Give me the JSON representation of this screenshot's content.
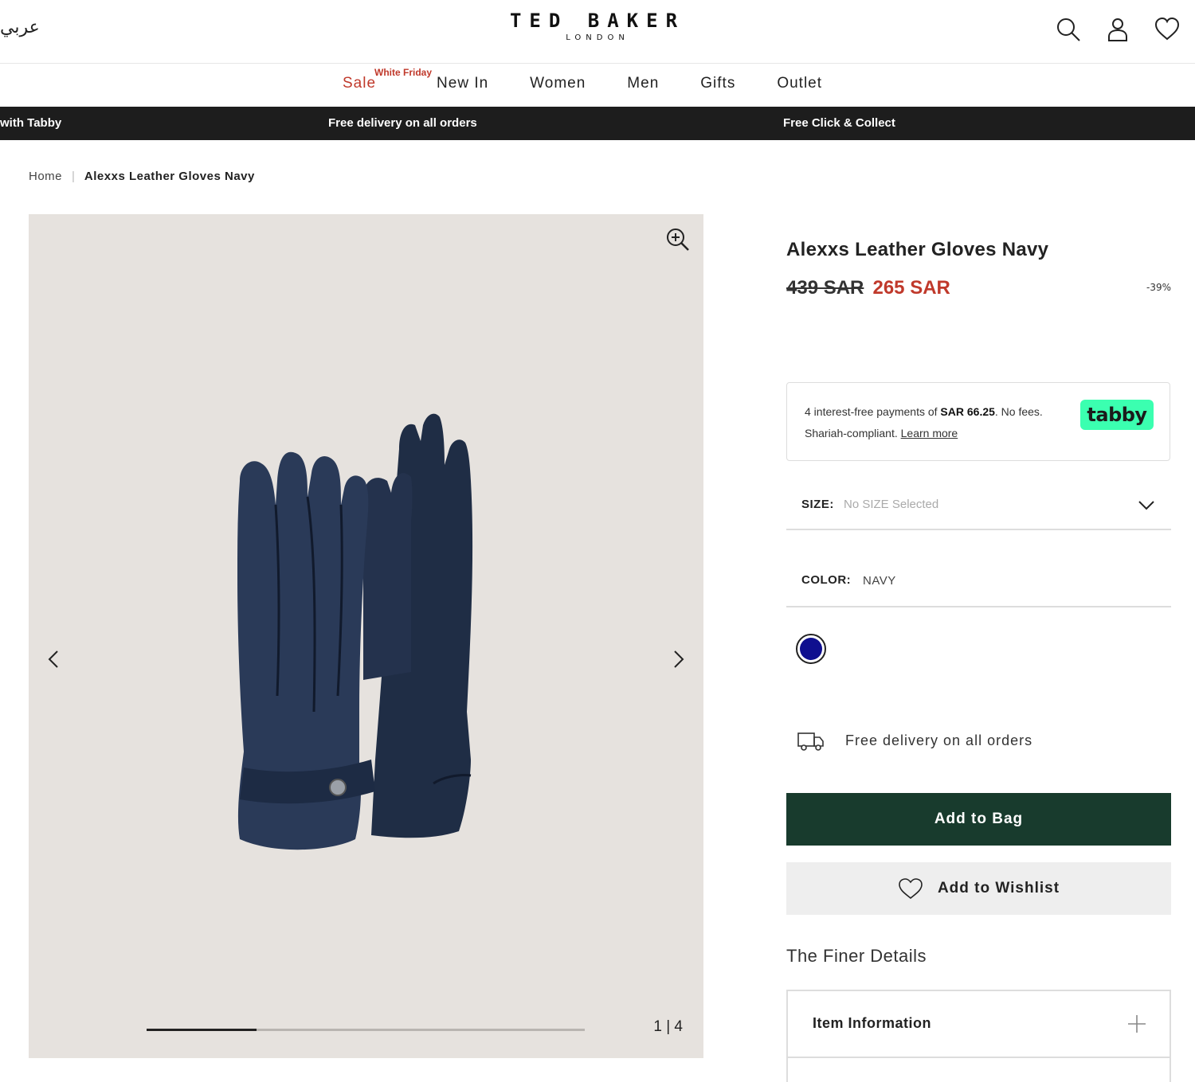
{
  "header": {
    "lang_label": "عربي",
    "logo_main": "TED BAKER",
    "logo_sub": "LONDON",
    "icons": [
      "search-icon",
      "account-icon",
      "wishlist-icon"
    ]
  },
  "nav": {
    "sale_label": "Sale",
    "sale_tag": "White Friday",
    "items": [
      "New In",
      "Women",
      "Men",
      "Gifts",
      "Outlet"
    ]
  },
  "promo": {
    "messages": [
      "with Tabby",
      "Free delivery on all orders",
      "Free Click & Collect"
    ]
  },
  "breadcrumb": {
    "home": "Home",
    "separator": "|",
    "current": "Alexxs Leather Gloves Navy"
  },
  "gallery": {
    "current": "1",
    "separator": "|",
    "total": "4",
    "progress": 0.25
  },
  "product": {
    "title": "Alexxs Leather Gloves Navy",
    "old_price": "439 SAR",
    "new_price": "265 SAR",
    "discount": "-39%"
  },
  "tabby": {
    "text_pre": "4 interest-free payments of ",
    "amount": "SAR 66.25",
    "text_post": ". No fees. Shariah-compliant. ",
    "link": "Learn more",
    "logo": "tabby",
    "logo_color": "#3bffb0"
  },
  "size": {
    "label": "SIZE:",
    "placeholder": "No SIZE Selected"
  },
  "color": {
    "label": "COLOR:",
    "value": "NAVY",
    "swatch": "#0f0f8f"
  },
  "delivery": {
    "text": "Free delivery on all orders"
  },
  "actions": {
    "add_to_bag": "Add to Bag",
    "add_to_wishlist": "Add to Wishlist",
    "bag_color": "#183b2d"
  },
  "details": {
    "heading": "The Finer Details",
    "accordion_1": "Item Information"
  }
}
